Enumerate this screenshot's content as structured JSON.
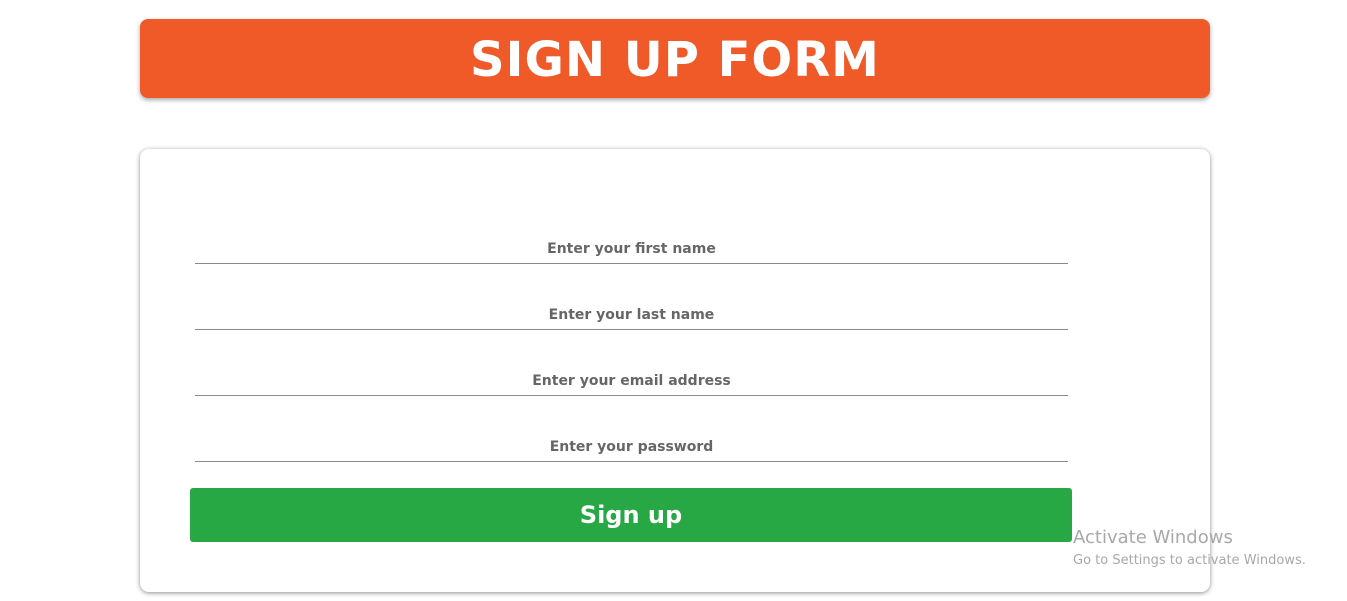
{
  "colors": {
    "header_bg": "#f05a28",
    "button_bg": "#28a745",
    "watermark_text": "#a8a8a8"
  },
  "header": {
    "title": "SIGN UP FORM"
  },
  "form": {
    "fields": [
      {
        "name": "first_name",
        "placeholder": "Enter your first name",
        "value": ""
      },
      {
        "name": "last_name",
        "placeholder": "Enter your last name",
        "value": ""
      },
      {
        "name": "email",
        "placeholder": "Enter your email address",
        "value": ""
      },
      {
        "name": "password",
        "placeholder": "Enter your password",
        "value": ""
      }
    ],
    "submit_label": "Sign up"
  },
  "watermark": {
    "title": "Activate Windows",
    "subtitle": "Go to Settings to activate Windows."
  }
}
